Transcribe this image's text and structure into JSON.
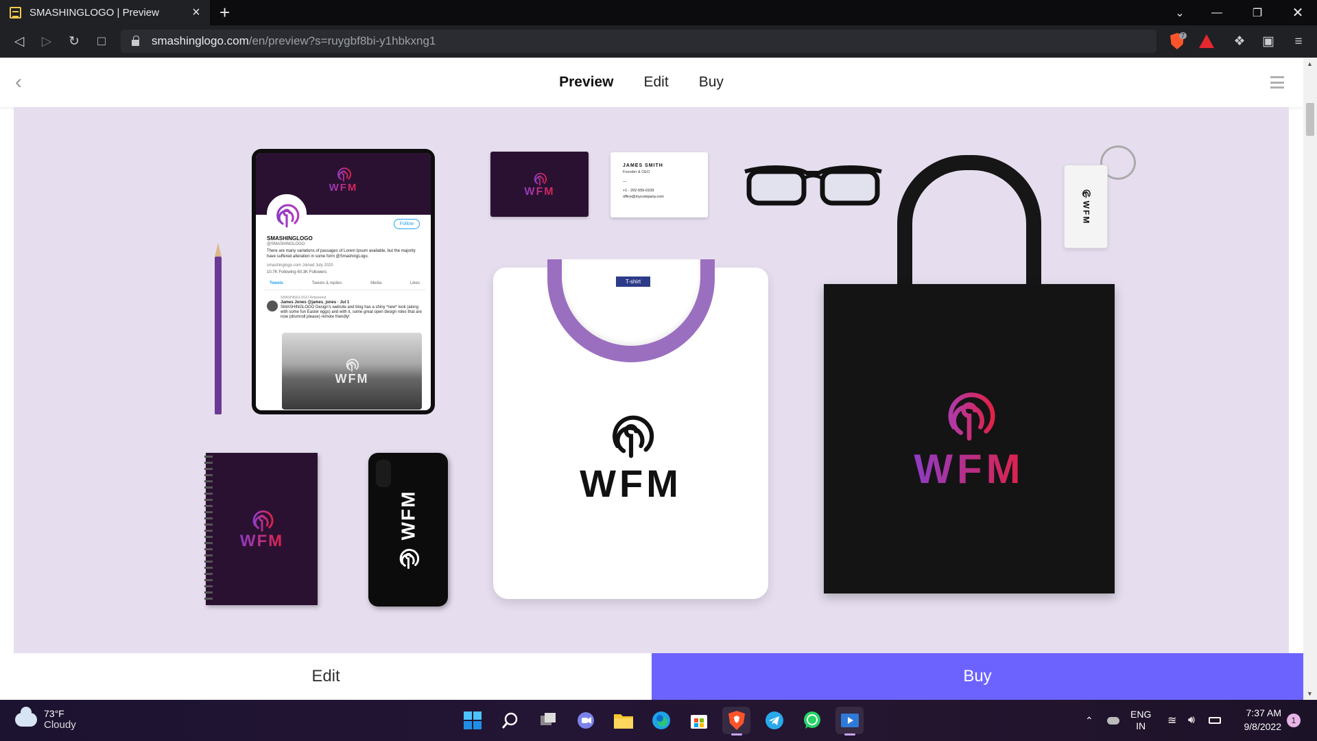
{
  "browser": {
    "tab_title": "SMASHINGLOGO | Preview",
    "tab_close": "×",
    "new_tab": "+",
    "url_host": "smashinglogo.com",
    "url_path": "/en/preview?s=ruygbf8bi-y1hbkxng1",
    "shield_count": "7"
  },
  "site_nav": {
    "preview": "Preview",
    "edit": "Edit",
    "buy": "Buy"
  },
  "brand": {
    "logo_text": "WFM"
  },
  "twitter_mock": {
    "follow": "Follow",
    "name": "SMASHINGLOGO",
    "handle": "@SMASHINGLOGO",
    "bio": "There are many variations of passages of Lorem Ipsum available, but the majority have suffered alteration in some form @SmashingLogo.",
    "meta": "smashinglogo.com   Joined July 2020",
    "stats": "10.7K Following   60.3K Followers",
    "tabs": [
      "Tweets",
      "Tweets & replies",
      "Media",
      "Likes"
    ],
    "retweet_label": "SMASHINGLOGO Retweeted",
    "post_author": "James Jones @james_jones · Jul 1",
    "post_text": "SMASHINGLOGO Design's website and blog has a shiny *new* look (along with some fun Easter eggs) and with it, some great open design roles that are now (drumroll please) remote friendly!"
  },
  "business_card": {
    "name": "JAMES SMITH",
    "title": "Founder & CEO",
    "dash": "—",
    "phone": "+1 - 202-555-0109",
    "email": "office@mycompany.com"
  },
  "tshirt_tag": "T-shirt",
  "actions": {
    "edit": "Edit",
    "buy": "Buy"
  },
  "taskbar": {
    "temperature": "73°F",
    "condition": "Cloudy",
    "lang_line1": "ENG",
    "lang_line2": "IN",
    "time": "7:37 AM",
    "date": "9/8/2022",
    "notifications": "1"
  },
  "colors": {
    "buy_button": "#6c63ff",
    "stage_bg": "#e6deef",
    "brand_dark": "#2b1131",
    "brand_gradient_start": "#8e3cc4",
    "brand_gradient_end": "#e02248"
  }
}
